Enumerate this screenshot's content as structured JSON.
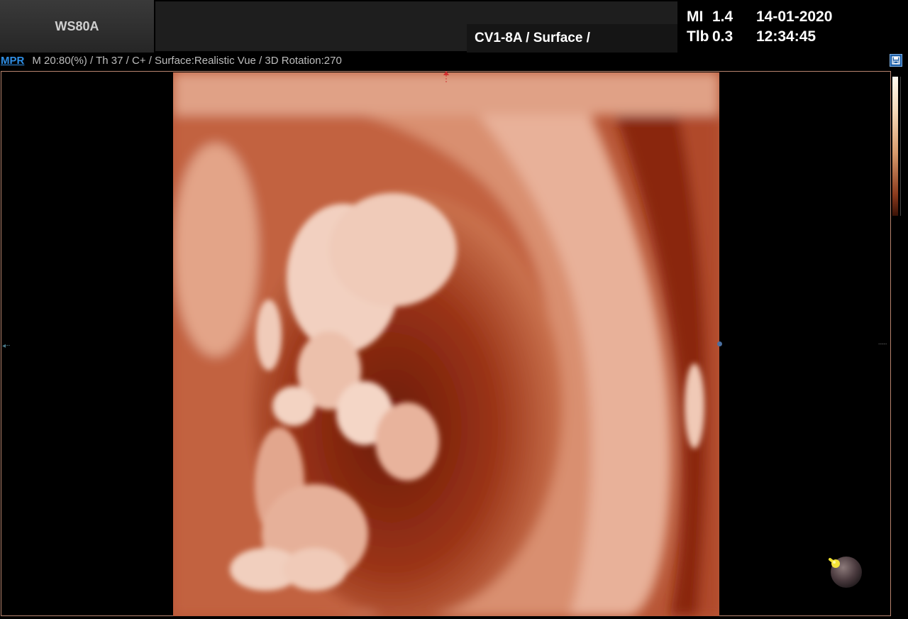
{
  "header": {
    "model": "WS80A",
    "probe_preset": "CV1-8A / Surface /",
    "mi_label": "MI",
    "mi_value": "1.4",
    "tib_label": "Tlb",
    "tib_value": "0.3",
    "date": "14-01-2020",
    "time": "12:34:45"
  },
  "infobar": {
    "mode_tab": "MPR",
    "parameters": "M 20:80(%) / Th 37 / C+ / Surface:Realistic Vue / 3D Rotation:270"
  },
  "icons": {
    "save": "save-icon",
    "orientation": "orientation-marker-icon"
  },
  "colors": {
    "accent_blue": "#2f8fe6",
    "viewport_border": "#b8846e",
    "render_tint": "#c4623f"
  }
}
